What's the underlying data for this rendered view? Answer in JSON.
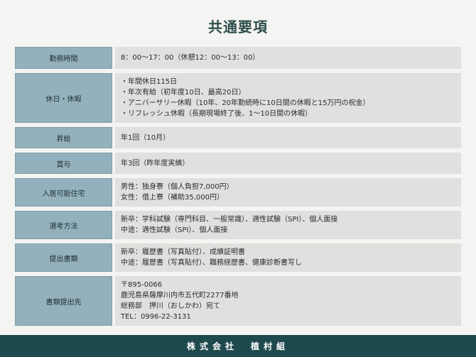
{
  "title": "共通要項",
  "rows": [
    {
      "label": "勤務時間",
      "lines": [
        "8：00〜17：00（休憩12：00〜13：00）"
      ]
    },
    {
      "label": "休日・休暇",
      "lines": [
        "・年間休日115日",
        "・年次有給（初年度10日、最高20日）",
        "・アニバーサリー休暇（10年、20年勤続時に10日間の休暇と15万円の祝金）",
        "・リフレッシュ休暇（長期現場終了後、1〜10日間の休暇）"
      ]
    },
    {
      "label": "昇給",
      "lines": [
        "年1回（10月）"
      ]
    },
    {
      "label": "賞与",
      "lines": [
        "年3回（昨年度実績）"
      ]
    },
    {
      "label": "入居可能住宅",
      "lines": [
        "男性：独身寮（個人負担7,000円）",
        "女性：借上寮（補助35,000円）"
      ]
    },
    {
      "label": "選考方法",
      "lines": [
        "新卒：学科試験（専門科目、一般常識）、適性試験（SPI）、個人面接",
        "中途：適性試験（SPI）、個人面接"
      ]
    },
    {
      "label": "提出書類",
      "lines": [
        "新卒：履歴書（写真貼付）、成績証明書",
        "中途：履歴書（写真貼付）、職務経歴書、健康診断書写し"
      ]
    },
    {
      "label": "書類提出先",
      "lines": [
        "〒895-0066",
        "鹿児島県薩摩川内市五代町2277番地",
        "総務部　押川（おしかわ）宛て",
        "TEL：0996-22-3131"
      ]
    }
  ],
  "footer": "株式会社　植村組",
  "colors": {
    "label_bg": "#93b1bd",
    "value_bg": "#e0e0df",
    "footer_bg": "#1f4a4d",
    "title": "#2e4e4c"
  }
}
